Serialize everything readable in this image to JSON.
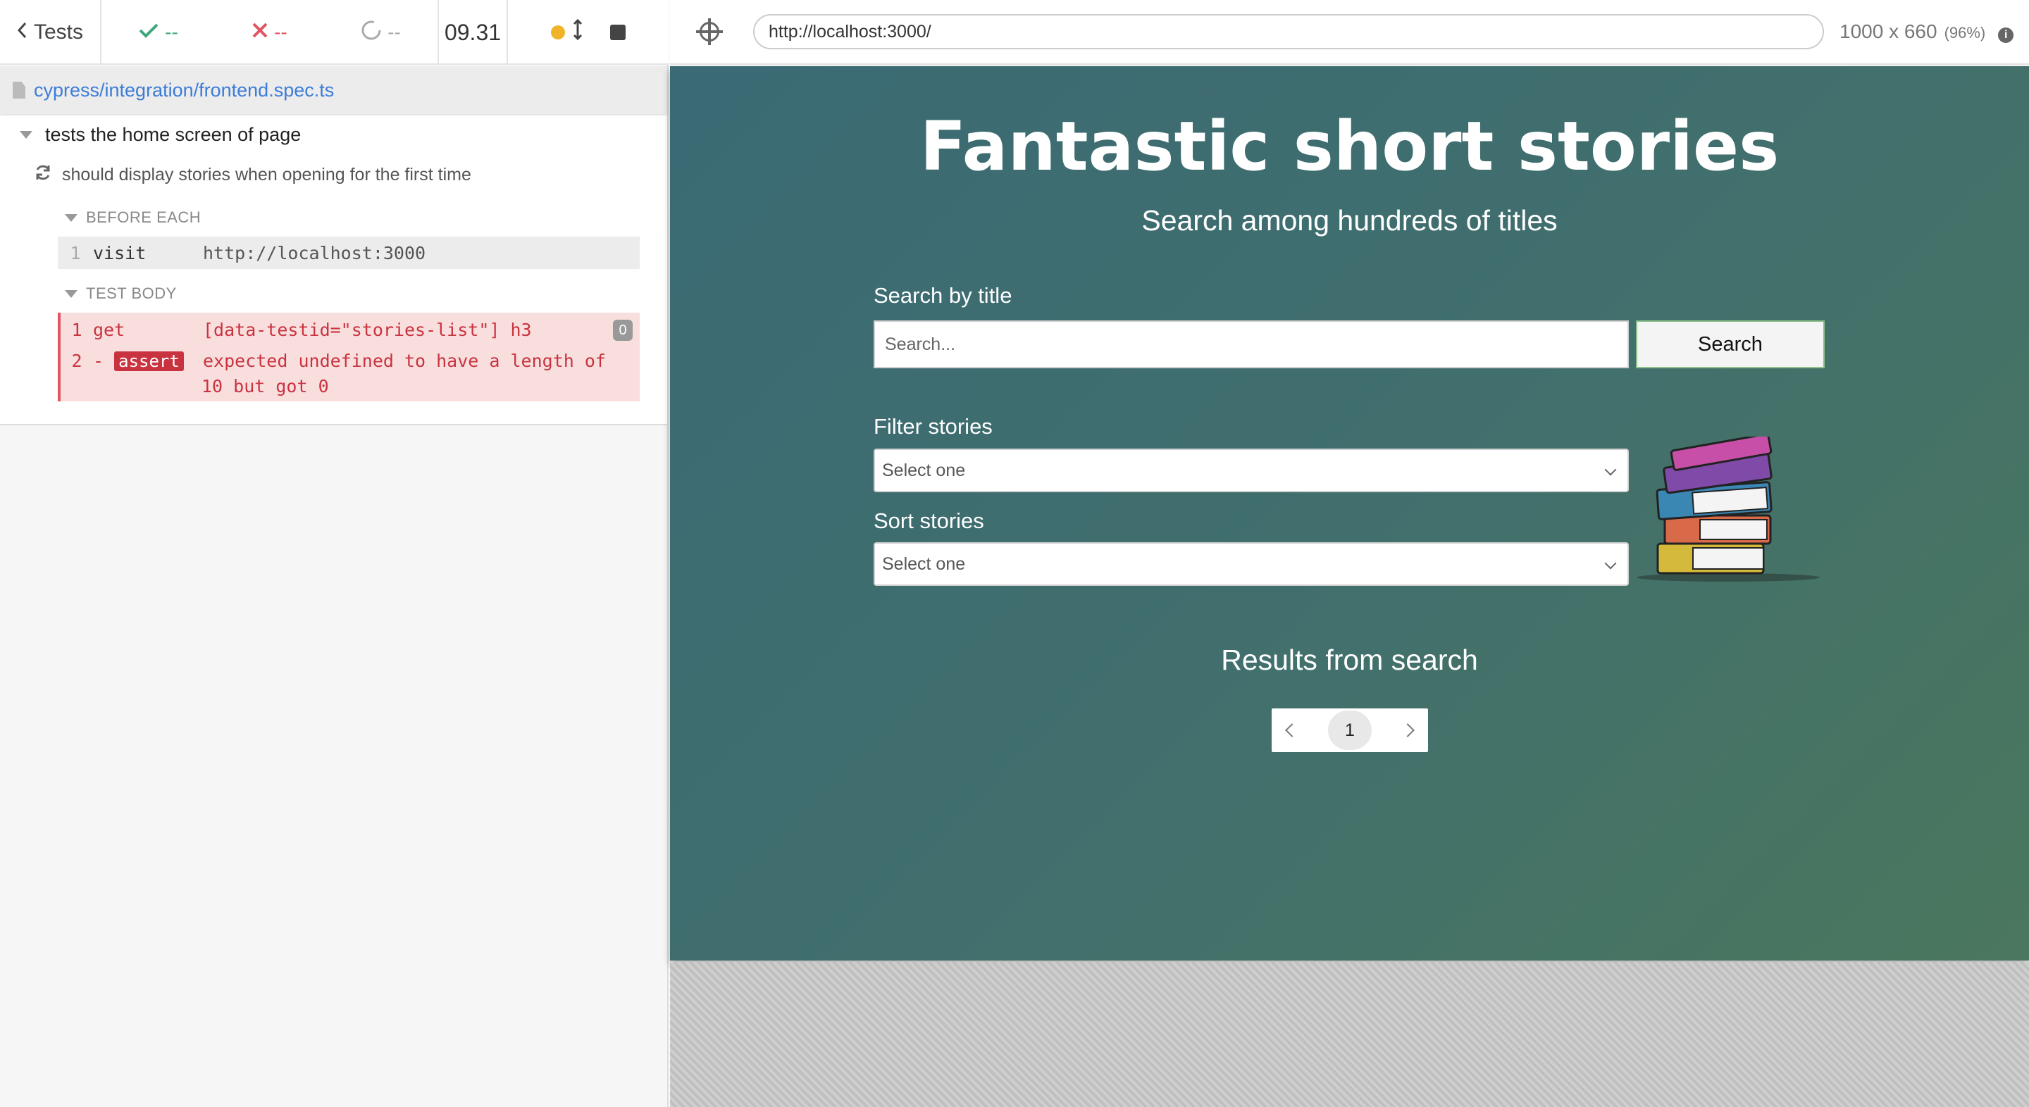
{
  "reporter": {
    "tests_label": "Tests",
    "passed": "--",
    "failed": "--",
    "pending": "--",
    "duration": "09.31",
    "spec_path": "cypress/integration/frontend.spec.ts",
    "suite_title": "tests the home screen of page",
    "test_title": "should display stories when opening for the first time",
    "before_each_label": "BEFORE EACH",
    "test_body_label": "TEST BODY",
    "visit_cmd": {
      "num": "1",
      "name": "visit",
      "message": "http://localhost:3000"
    },
    "get_cmd": {
      "num": "1",
      "name": "get",
      "message": "[data-testid=\"stories-list\"] h3",
      "badge": "0"
    },
    "assert_cmd": {
      "num": "2",
      "prefix": "-",
      "name": "assert",
      "message_line1": "expected undefined to have a length of",
      "message_line2": "10 but got 0"
    }
  },
  "aut": {
    "url": "http://localhost:3000/",
    "viewport": "1000 x 660",
    "scale": "(96%)"
  },
  "site": {
    "title": "Fantastic short stories",
    "subtitle": "Search among hundreds of titles",
    "search_label": "Search by title",
    "search_placeholder": "Search...",
    "search_button": "Search",
    "filter_label": "Filter stories",
    "filter_value": "Select one",
    "sort_label": "Sort stories",
    "sort_value": "Select one",
    "results_title": "Results from search",
    "current_page": "1"
  },
  "colors": {
    "pass": "#3ea77a",
    "fail": "#e05561",
    "link": "#3b7dd8"
  }
}
